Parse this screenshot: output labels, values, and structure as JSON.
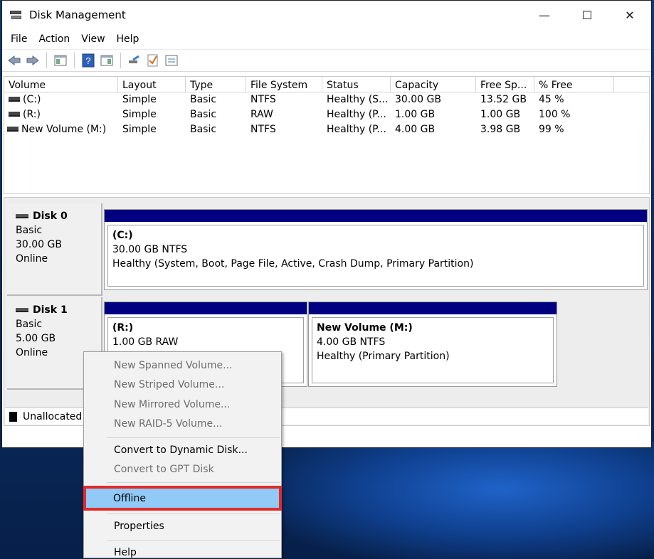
{
  "window": {
    "title": "Disk Management",
    "min_label": "—",
    "max_label": "☐",
    "close_label": "✕"
  },
  "menu": [
    "File",
    "Action",
    "View",
    "Help"
  ],
  "toolbar": {
    "icons": [
      "back-arrow-icon",
      "forward-arrow-icon",
      "console-tree-icon",
      "help-icon",
      "action-pane-icon",
      "rescan-disks-icon",
      "check-icon",
      "properties-icon"
    ]
  },
  "volume_list": {
    "headers": [
      "Volume",
      "Layout",
      "Type",
      "File System",
      "Status",
      "Capacity",
      "Free Sp...",
      "% Free"
    ],
    "rows": [
      [
        "(C:)",
        "Simple",
        "Basic",
        "NTFS",
        "Healthy (S...",
        "30.00 GB",
        "13.52 GB",
        "45 %"
      ],
      [
        "(R:)",
        "Simple",
        "Basic",
        "RAW",
        "Healthy (P...",
        "1.00 GB",
        "1.00 GB",
        "100 %"
      ],
      [
        "New Volume (M:)",
        "Simple",
        "Basic",
        "NTFS",
        "Healthy (P...",
        "4.00 GB",
        "3.98 GB",
        "99 %"
      ]
    ]
  },
  "disks": [
    {
      "name": "Disk 0",
      "type": "Basic",
      "size": "30.00 GB",
      "status": "Online",
      "partitions": [
        {
          "name": "(C:)",
          "fs": "30.00 GB NTFS",
          "status": "Healthy (System, Boot, Page File, Active, Crash Dump, Primary Partition)"
        }
      ]
    },
    {
      "name": "Disk 1",
      "type": "Basic",
      "size": "5.00 GB",
      "status": "Online",
      "partitions": [
        {
          "name": "(R:)",
          "fs": "1.00 GB RAW",
          "status": ""
        },
        {
          "name": "New Volume  (M:)",
          "fs": "4.00 GB NTFS",
          "status": "Healthy (Primary Partition)"
        }
      ]
    }
  ],
  "legend": {
    "unallocated": "Unallocated"
  },
  "context_menu": {
    "items": [
      {
        "label": "New Spanned Volume...",
        "enabled": false
      },
      {
        "label": "New Striped Volume...",
        "enabled": false
      },
      {
        "label": "New Mirrored Volume...",
        "enabled": false
      },
      {
        "label": "New RAID-5 Volume...",
        "enabled": false
      },
      {
        "label": "Convert to Dynamic Disk...",
        "enabled": true
      },
      {
        "label": "Convert to GPT Disk",
        "enabled": false
      },
      {
        "label": "Offline",
        "enabled": true,
        "highlighted": true
      },
      {
        "label": "Properties",
        "enabled": true
      },
      {
        "label": "Help",
        "enabled": true
      }
    ]
  },
  "colors": {
    "partition_bar": "#000080",
    "highlight_fill": "#91c9f7",
    "highlight_border": "#e22b2b"
  }
}
